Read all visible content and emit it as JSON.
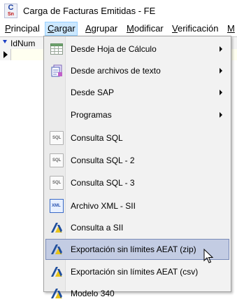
{
  "window": {
    "title": "Carga de Facturas Emitidas - FE",
    "icon_letters_top": "C",
    "icon_letters_bottom": "Sn"
  },
  "menubar": {
    "items": [
      {
        "label": "Principal",
        "underline_letter": "P"
      },
      {
        "label": "Cargar",
        "underline_letter": "C",
        "open": true
      },
      {
        "label": "Agrupar",
        "underline_letter": "A"
      },
      {
        "label": "Modificar",
        "underline_letter": "M"
      },
      {
        "label": "Verificación",
        "underline_letter": "V"
      },
      {
        "label": "M",
        "underline_letter": "M"
      }
    ]
  },
  "grid": {
    "column_header": "IdNum"
  },
  "dropdown": {
    "items": [
      {
        "label": "Desde Hoja de Cálculo",
        "icon": "spreadsheet-icon",
        "submenu": true
      },
      {
        "label": "Desde archivos de texto",
        "icon": "text-files-icon",
        "submenu": true
      },
      {
        "label": "Desde SAP",
        "icon": "",
        "submenu": true
      },
      {
        "label": "Programas",
        "icon": "",
        "submenu": true
      },
      {
        "label": "Consulta SQL",
        "icon": "sql-icon",
        "icon_text": "SQL",
        "submenu": false
      },
      {
        "label": "Consulta SQL - 2",
        "icon": "sql-icon",
        "icon_text": "SQL",
        "submenu": false
      },
      {
        "label": "Consulta SQL - 3",
        "icon": "sql-icon",
        "icon_text": "SQL",
        "submenu": false
      },
      {
        "label": "Archivo XML - SII",
        "icon": "xml-icon",
        "icon_text": "XML",
        "submenu": false
      },
      {
        "label": "Consulta a SII",
        "icon": "aeat-icon",
        "submenu": false
      },
      {
        "label": "Exportación sin límites AEAT (zip)",
        "icon": "aeat-icon",
        "submenu": false,
        "highlighted": true
      },
      {
        "label": "Exportación sin límites AEAT (csv)",
        "icon": "aeat-icon",
        "submenu": false
      },
      {
        "label": "Modelo 340",
        "icon": "aeat-icon",
        "submenu": false
      }
    ]
  },
  "colors": {
    "menu_open_bg": "#cce8ff",
    "hover_bg": "#c3cce3",
    "hover_border": "#7a8bb8",
    "aeat_blue": "#1f4e9c",
    "aeat_yellow": "#e8c31a"
  }
}
